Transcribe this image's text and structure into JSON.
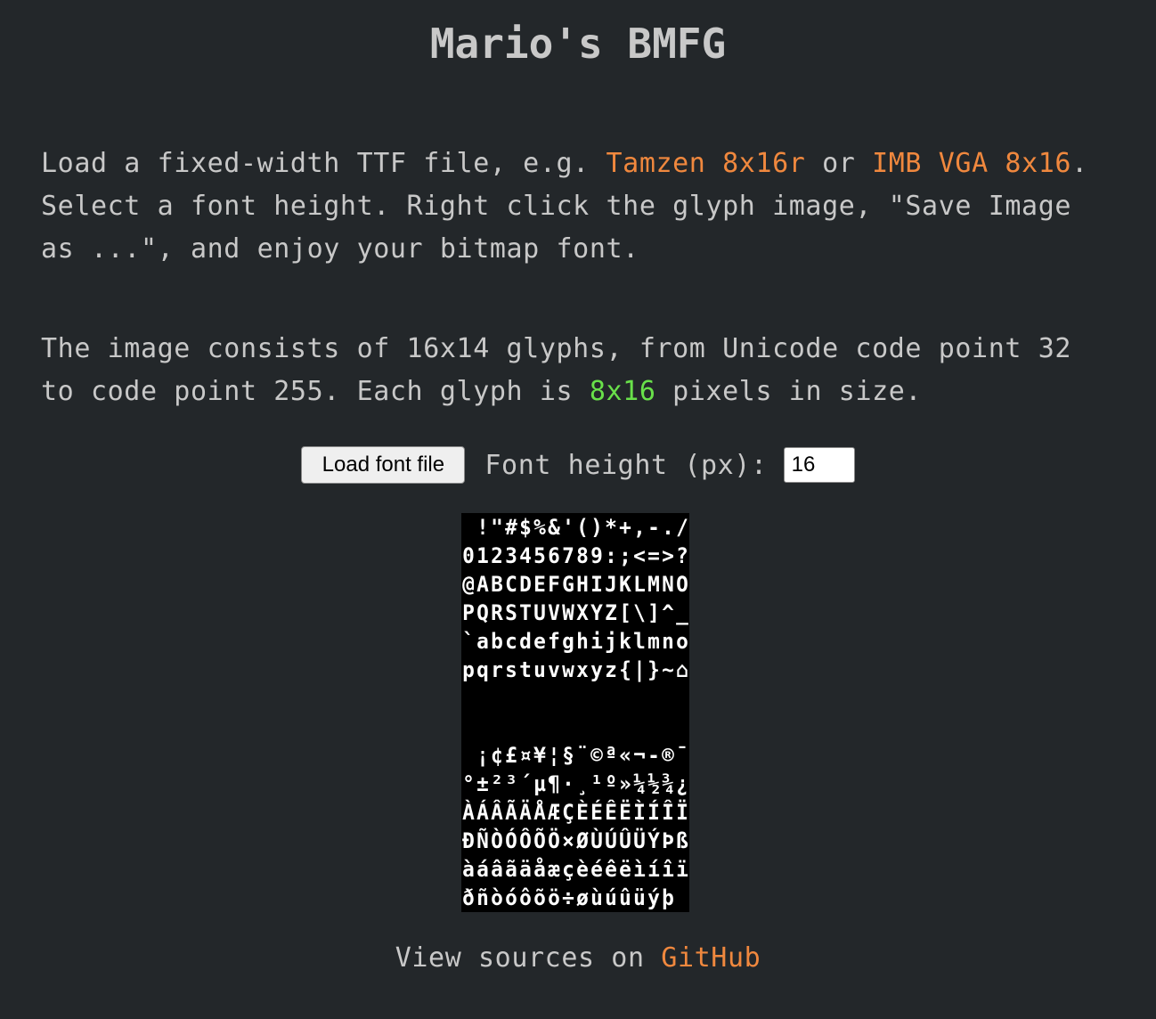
{
  "title": "Mario's BMFG",
  "intro": {
    "text1": "Load a fixed-width TTF file, e.g. ",
    "link1": "Tamzen 8x16r",
    "text2": " or ",
    "link2": "IMB VGA 8x16",
    "text3": ". Select a font height. Right click the glyph image, \"Save Image as ...\", and enjoy your bitmap font."
  },
  "info": {
    "text1": "The image consists of 16x14 glyphs, from Unicode code point 32 to code point 255. Each glyph is ",
    "size": "8x16",
    "text2": " pixels in size."
  },
  "controls": {
    "load_button": "Load font file",
    "height_label": "Font height (px):",
    "height_value": "16"
  },
  "glyph_rows": [
    " !\"#$%&'()*+,-./",
    "0123456789:;<=>?",
    "@ABCDEFGHIJKLMNO",
    "PQRSTUVWXYZ[\\]^_",
    "`abcdefghijklmno",
    "pqrstuvwxyz{|}~⌂",
    "                ",
    "                ",
    " ¡¢£¤¥¦§¨©ª«¬-®¯",
    "°±²³´µ¶·¸¹º»¼½¾¿",
    "ÀÁÂÃÄÅÆÇÈÉÊËÌÍÎÏ",
    "ÐÑÒÓÔÕÖ×ØÙÚÛÜÝÞß",
    "àáâãäåæçèéêëìíîï",
    "ðñòóôõö÷øùúûüýþ "
  ],
  "footer": {
    "text": "View sources on ",
    "link": "GitHub"
  }
}
